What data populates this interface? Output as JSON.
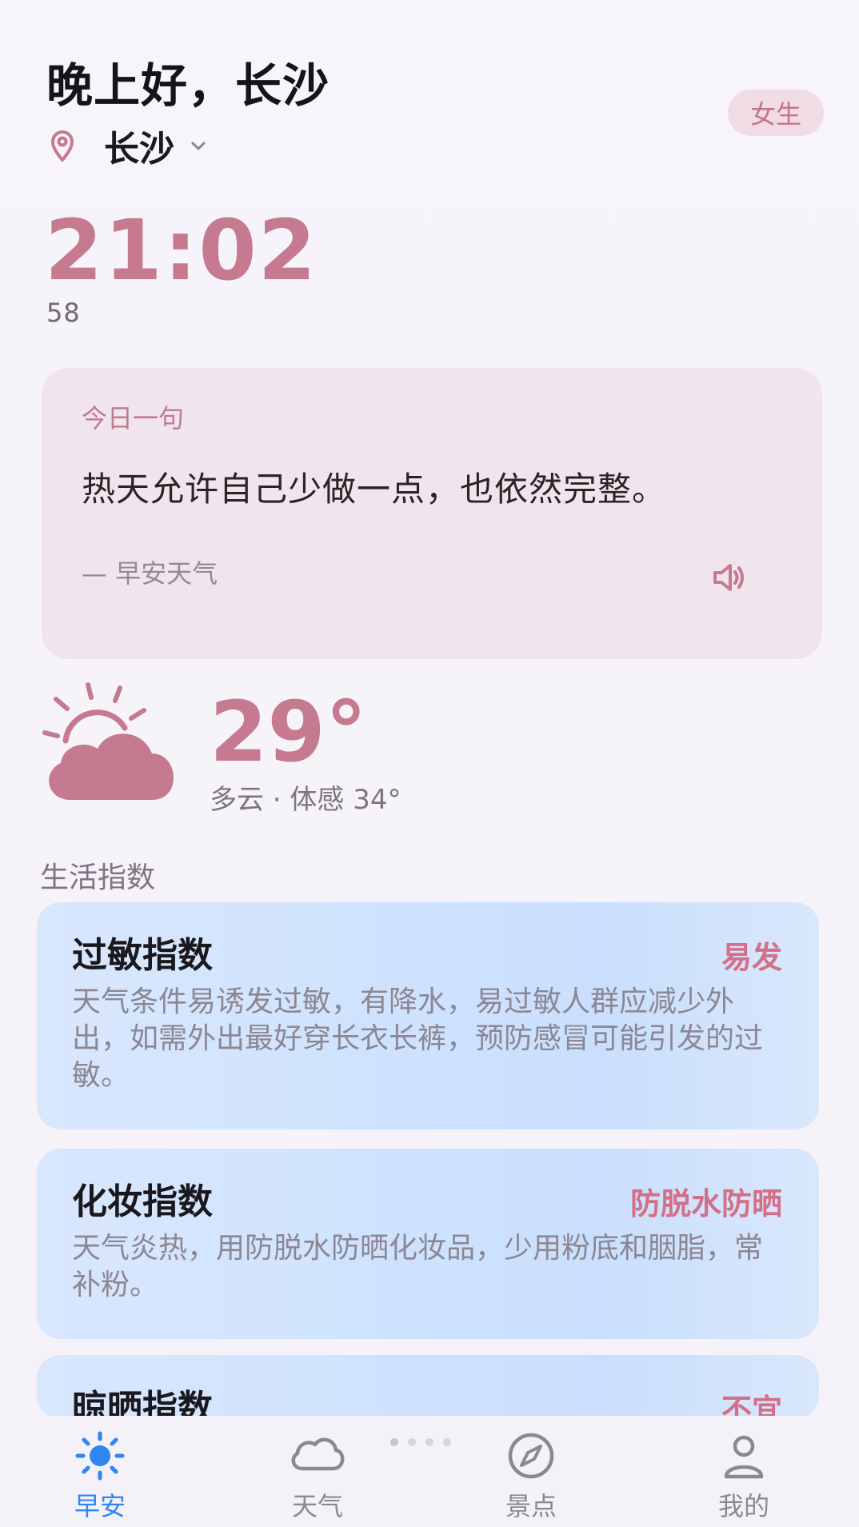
{
  "header": {
    "greeting": "晚上好，长沙",
    "gender_badge": "女生",
    "location": "长沙"
  },
  "clock": {
    "time": "21:02",
    "seconds": "58"
  },
  "quote": {
    "label": "今日一句",
    "text": "热天允许自己少做一点，也依然完整。",
    "source": "— 早安天气"
  },
  "weather": {
    "temperature": "29°",
    "condition": "多云 · 体感 34°",
    "icon": "partly-cloudy-sun-icon"
  },
  "life_index": {
    "section_title": "生活指数",
    "cards": [
      {
        "title": "过敏指数",
        "level": "易发",
        "description": "天气条件易诱发过敏，有降水，易过敏人群应减少外出，如需外出最好穿长衣长裤，预防感冒可能引发的过敏。"
      },
      {
        "title": "化妆指数",
        "level": "防脱水防晒",
        "description": "天气炎热，用防脱水防晒化妆品，少用粉底和胭脂，常补粉。"
      },
      {
        "title": "晾晒指数",
        "level": "不宜"
      }
    ]
  },
  "bottom_nav": {
    "items": [
      {
        "label": "早安",
        "icon": "sun-icon",
        "active": true
      },
      {
        "label": "天气",
        "icon": "cloud-icon",
        "active": false
      },
      {
        "label": "景点",
        "icon": "compass-icon",
        "active": false
      },
      {
        "label": "我的",
        "icon": "profile-icon",
        "active": false
      }
    ]
  },
  "colors": {
    "accent_pink": "#c57a90",
    "nav_active": "#2d86f2",
    "badge_bg": "#f1dce5",
    "quote_bg": "#f1e5ed",
    "card_blue": "#cfe3fe"
  }
}
